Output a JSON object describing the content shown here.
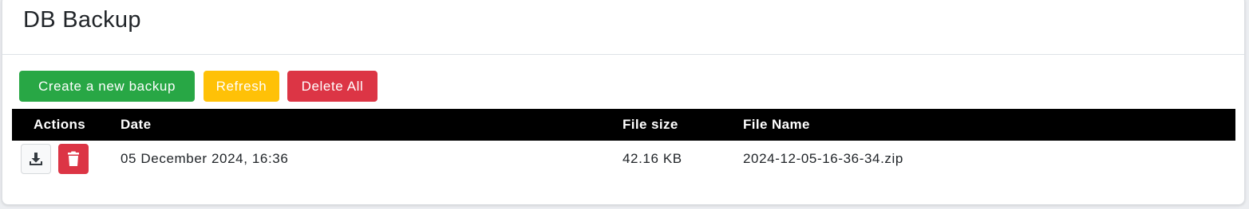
{
  "header": {
    "title": "DB Backup"
  },
  "toolbar": {
    "create_label": "Create a new backup",
    "refresh_label": "Refresh",
    "delete_all_label": "Delete All"
  },
  "table": {
    "columns": [
      "Actions",
      "Date",
      "File size",
      "File Name"
    ],
    "rows": [
      {
        "actions": [
          "download-icon",
          "trash-icon"
        ],
        "date": "05 December 2024, 16:36",
        "size": "42.16 KB",
        "name": "2024-12-05-16-36-34.zip"
      }
    ]
  },
  "colors": {
    "success": "#28a745",
    "warning": "#ffc107",
    "danger": "#dc3545",
    "table_header_bg": "#000000"
  }
}
